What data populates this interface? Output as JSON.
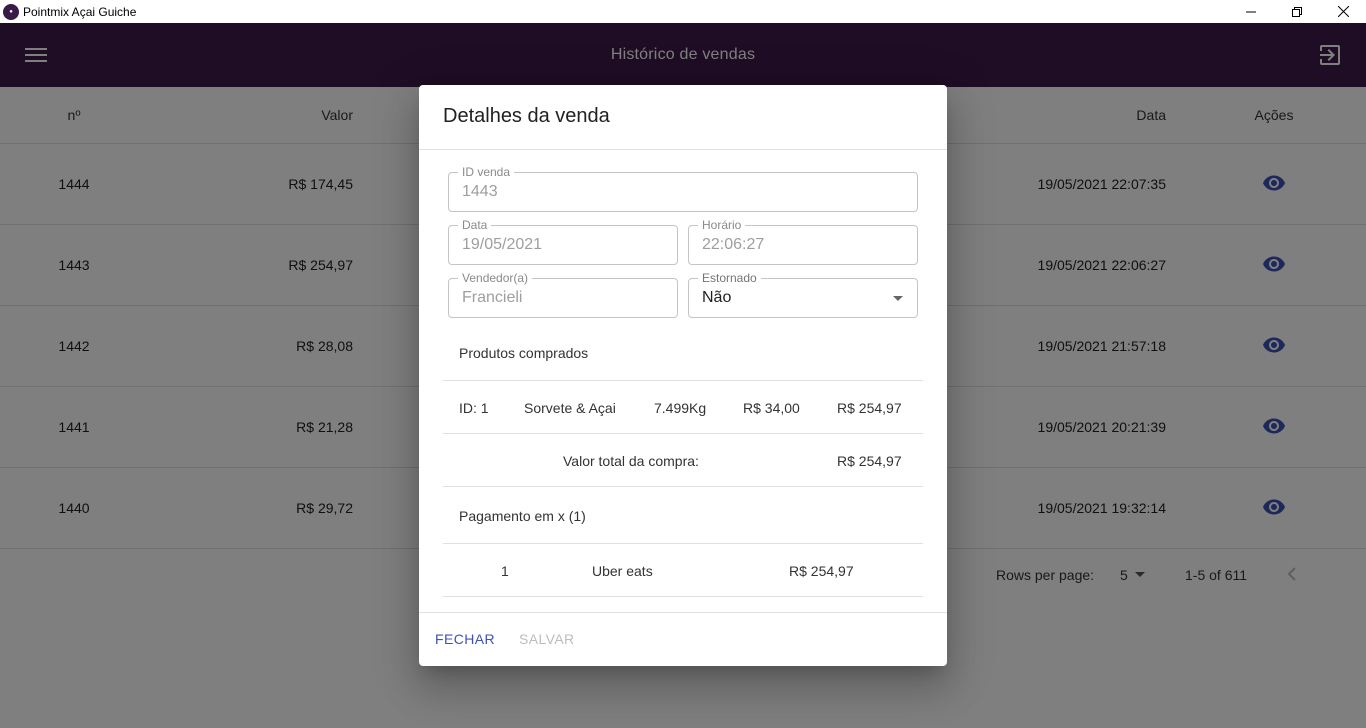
{
  "window": {
    "title": "Pointmix Açai Guiche",
    "icon": "app-logo-icon",
    "controls": [
      "minimize-icon",
      "restore-icon",
      "close-icon"
    ]
  },
  "appbar": {
    "title": "Histórico de vendas",
    "menu_icon": "menu-icon",
    "logout_icon": "logout-icon",
    "color": "#3d1a48"
  },
  "table": {
    "headers": {
      "num": "nº",
      "value": "Valor",
      "date": "Data",
      "actions": "Ações"
    },
    "rows": [
      {
        "num": "1444",
        "value": "R$ 174,45",
        "date": "19/05/2021 22:07:35"
      },
      {
        "num": "1443",
        "value": "R$ 254,97",
        "date": "19/05/2021 22:06:27"
      },
      {
        "num": "1442",
        "value": "R$ 28,08",
        "date": "19/05/2021 21:57:18"
      },
      {
        "num": "1441",
        "value": "R$ 21,28",
        "date": "19/05/2021 20:21:39"
      },
      {
        "num": "1440",
        "value": "R$ 29,72",
        "date": "19/05/2021 19:32:14"
      }
    ],
    "action_icon": "eye-icon",
    "action_color": "#3f51b5"
  },
  "pagination": {
    "rows_per_page_label": "Rows per page:",
    "rows_per_page": "5",
    "range": "1-5 of 611"
  },
  "dialog": {
    "title": "Detalhes da venda",
    "id_label": "ID venda",
    "id_value": "1443",
    "date_label": "Data",
    "date_value": "19/05/2021",
    "time_label": "Horário",
    "time_value": "22:06:27",
    "seller_label": "Vendedor(a)",
    "seller_value": "Francieli",
    "refunded_label": "Estornado",
    "refunded_value": "Não",
    "products_label": "Produtos comprados",
    "product": {
      "id": "ID: 1",
      "name": "Sorvete & Açai",
      "weight": "7.499Kg",
      "unit_price": "R$ 34,00",
      "total": "R$ 254,97"
    },
    "total_label": "Valor total da compra:",
    "total_value": "R$ 254,97",
    "payment_label": "Pagamento em x (1)",
    "payment": {
      "index": "1",
      "method": "Uber eats",
      "amount": "R$ 254,97"
    },
    "close_button": "FECHAR",
    "save_button": "SALVAR"
  }
}
